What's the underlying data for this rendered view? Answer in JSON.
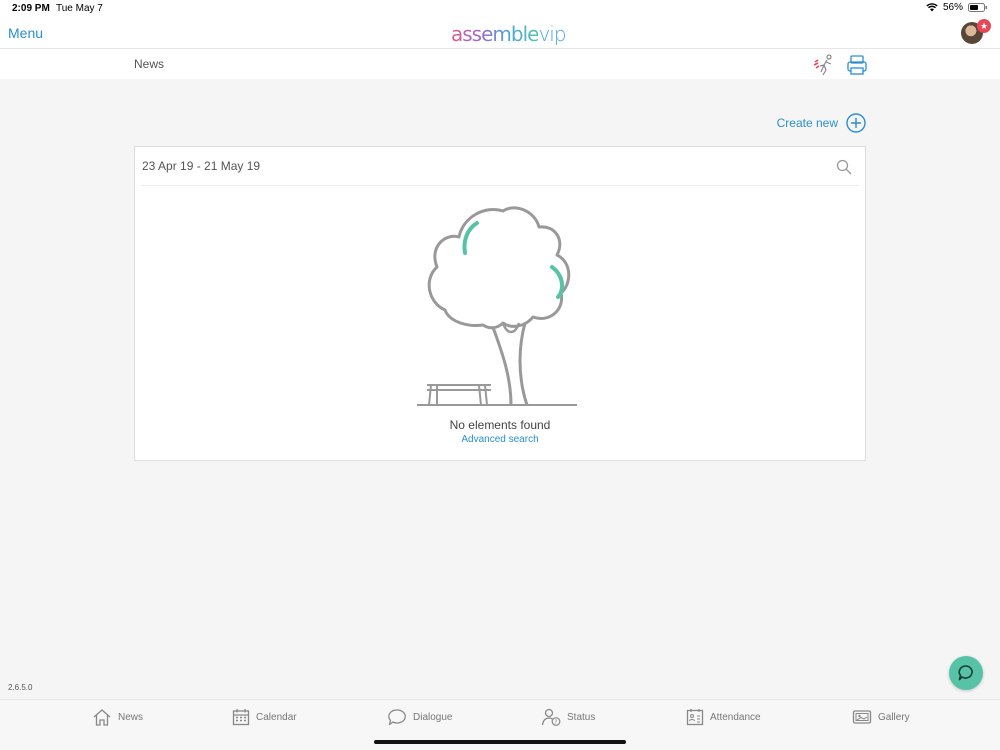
{
  "status_bar": {
    "time": "2:09 PM",
    "date": "Tue May 7",
    "battery": "56%"
  },
  "top_nav": {
    "menu_label": "Menu",
    "logo": {
      "part1": "assemble",
      "part2": "vip"
    },
    "avatar_badge": "★"
  },
  "sub_header": {
    "title": "News"
  },
  "actions": {
    "create_new_label": "Create new"
  },
  "panel": {
    "date_range": "23 Apr 19 - 21 May 19",
    "empty_message": "No elements found",
    "advanced_search_label": "Advanced search"
  },
  "footer": {
    "version": "2.6.5.0"
  },
  "tabs": [
    {
      "label": "News",
      "icon": "home-icon"
    },
    {
      "label": "Calendar",
      "icon": "calendar-icon"
    },
    {
      "label": "Dialogue",
      "icon": "speech-bubble-icon"
    },
    {
      "label": "Status",
      "icon": "person-question-icon"
    },
    {
      "label": "Attendance",
      "icon": "attendance-icon"
    },
    {
      "label": "Gallery",
      "icon": "gallery-icon"
    }
  ],
  "colors": {
    "accent": "#2a8fce",
    "chat": "#56c3a6",
    "tree_leaf": "#56c3a6",
    "badge": "#e84855"
  }
}
